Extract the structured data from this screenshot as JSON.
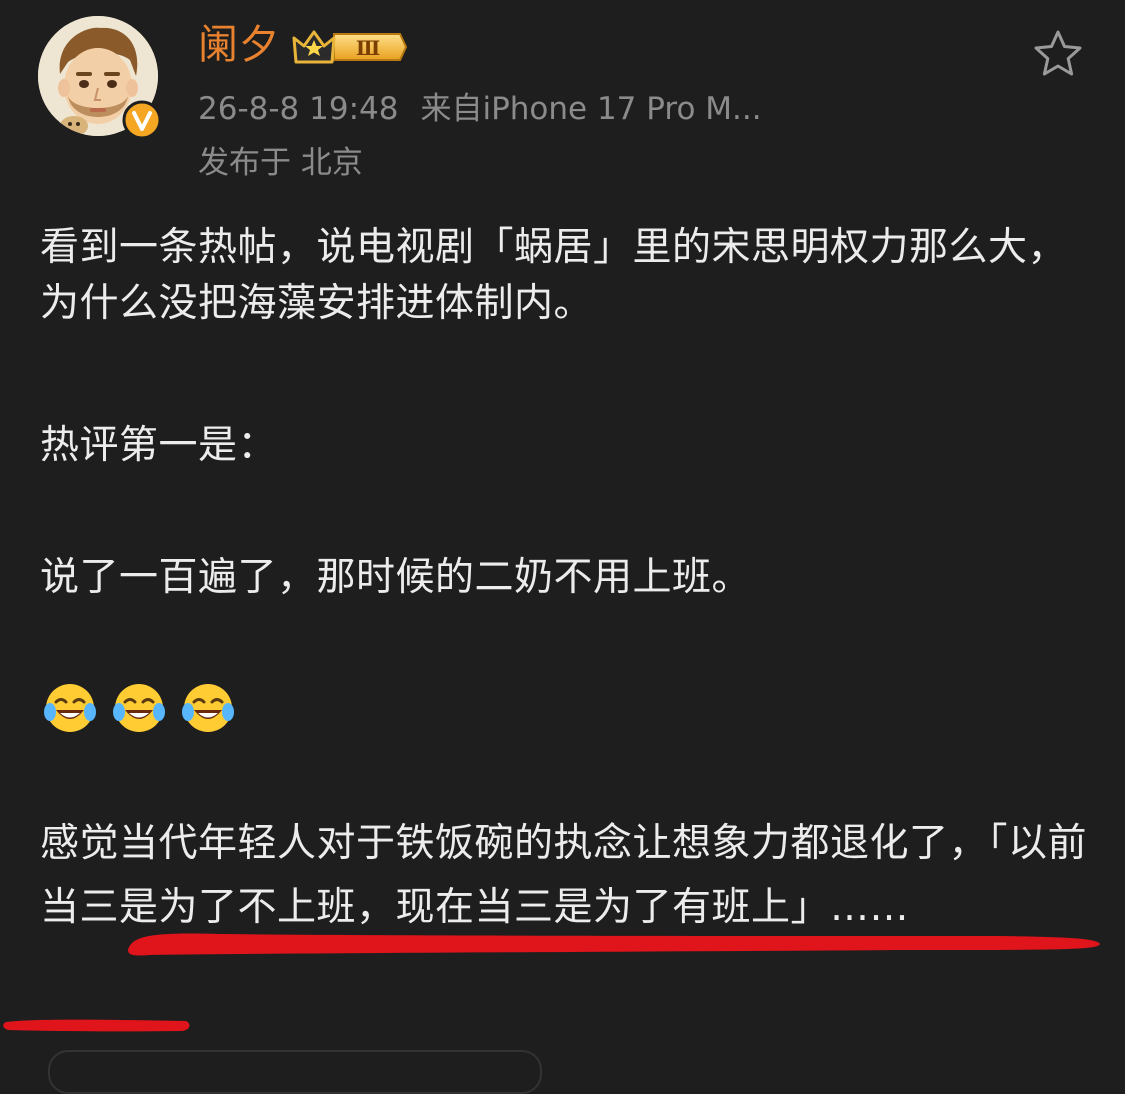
{
  "user": {
    "name": "阑夕",
    "badge_level": "Ⅲ"
  },
  "meta": {
    "timestamp": "26-8-8 19:48",
    "source": "来自iPhone 17 Pro M...",
    "location": "发布于 北京"
  },
  "content": {
    "para1": "看到一条热帖，说电视剧「蜗居」里的宋思明权力那么大，为什么没把海藻安排进体制内。",
    "para2": "热评第一是：",
    "para3": "说了一百遍了，那时候的二奶不用上班。",
    "emojis": [
      "laugh-cry-emoji",
      "laugh-cry-emoji",
      "laugh-cry-emoji"
    ],
    "para4": "感觉当代年轻人对于铁饭碗的执念让想象力都退化了，「以前当三是为了不上班，现在当三是为了有班上」……"
  },
  "colors": {
    "background": "#1e1e1e",
    "username": "#e8822e",
    "meta": "#8b8b8b",
    "text": "#ececec",
    "annotation": "#e0141b"
  },
  "icons": {
    "favorite": "star-outline-icon",
    "verified": "verified-v-icon"
  }
}
